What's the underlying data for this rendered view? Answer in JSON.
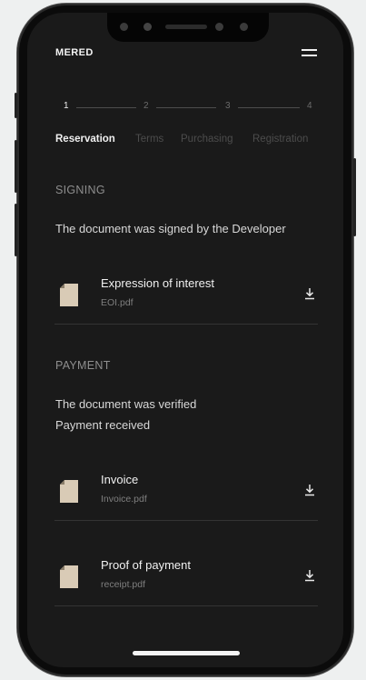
{
  "app": {
    "brand": "MERED"
  },
  "stepper": {
    "steps": [
      {
        "number": "1",
        "label": "Reservation",
        "active": true
      },
      {
        "number": "2",
        "label": "Terms",
        "active": false
      },
      {
        "number": "3",
        "label": "Purchasing",
        "active": false
      },
      {
        "number": "4",
        "label": "Registration",
        "active": false
      }
    ]
  },
  "signing": {
    "title": "SIGNING",
    "status": "The document was signed by the Developer",
    "documents": [
      {
        "title": "Expression of interest",
        "file": "EOI.pdf"
      }
    ]
  },
  "payment": {
    "title": "PAYMENT",
    "status_lines": [
      "The document was verified",
      "Payment received"
    ],
    "documents": [
      {
        "title": "Invoice",
        "file": "Invoice.pdf"
      },
      {
        "title": "Proof of payment",
        "file": "receipt.pdf"
      }
    ]
  },
  "colors": {
    "background": "#1a1a1a",
    "text_primary": "#f1f1f1",
    "text_muted": "#8e8e8e",
    "file_icon": "#d9cbb6"
  },
  "icons": {
    "menu": "hamburger-menu-icon",
    "document": "document-file-icon",
    "download": "download-icon"
  }
}
